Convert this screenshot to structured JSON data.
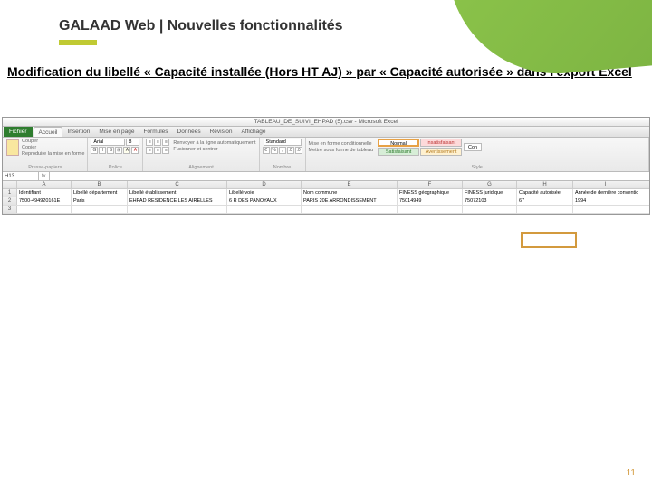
{
  "slide": {
    "title_prefix": "GALAAD Web",
    "title_sep": " | ",
    "title_suffix": "Nouvelles fonctionnalités",
    "subheading": "Modification du libellé « Capacité installée (Hors HT AJ) » par « Capacité autorisée » dans l'export Excel",
    "page_number": "11"
  },
  "excel": {
    "window_title": "TABLEAU_DE_SUIVI_EHPAD (5).csv - Microsoft Excel",
    "file_tab": "Fichier",
    "tabs": [
      "Accueil",
      "Insertion",
      "Mise en page",
      "Formules",
      "Données",
      "Révision",
      "Affichage"
    ],
    "active_tab_index": 0,
    "ribbon": {
      "clipboard": {
        "label": "Presse-papiers",
        "cut": "Couper",
        "copy": "Copier",
        "brush": "Reproduire la mise en forme"
      },
      "font": {
        "label": "Police",
        "name": "Arial",
        "size": "8"
      },
      "align": {
        "label": "Alignement",
        "wrap": "Renvoyer à la ligne automatiquement",
        "merge": "Fusionner et centrer"
      },
      "number": {
        "label": "Nombre",
        "format": "Standard"
      },
      "style": {
        "label": "Style",
        "cond": "Mise en forme conditionnelle",
        "table": "Mettre sous forme de tableau",
        "normal": "Normal",
        "insuff": "Insatisfaisant",
        "satisf": "Satisfaisant",
        "avert": "Avertissement",
        "con": "Con"
      }
    },
    "name_box": "H13",
    "columns": [
      "",
      "A",
      "B",
      "C",
      "D",
      "E",
      "F",
      "G",
      "H",
      "I"
    ],
    "header_row": {
      "num": "1",
      "cells": [
        "Identifiant",
        "Libellé département",
        "Libellé établissement",
        "Libellé voie",
        "Nom commune",
        "FINESS géographique",
        "FINESS juridique",
        "Capacité autorisée",
        "Année de dernière convention"
      ]
    },
    "data_row": {
      "num": "2",
      "cells": [
        "7500-494920161E",
        "Paris",
        "EHPAD RESIDENCE LES AIRELLES",
        "6 R DES PANOYAUX",
        "PARIS 20E ARRONDISSEMENT",
        "75014949",
        "75072103",
        "67",
        "1994"
      ]
    },
    "empty_row_num": "3"
  }
}
